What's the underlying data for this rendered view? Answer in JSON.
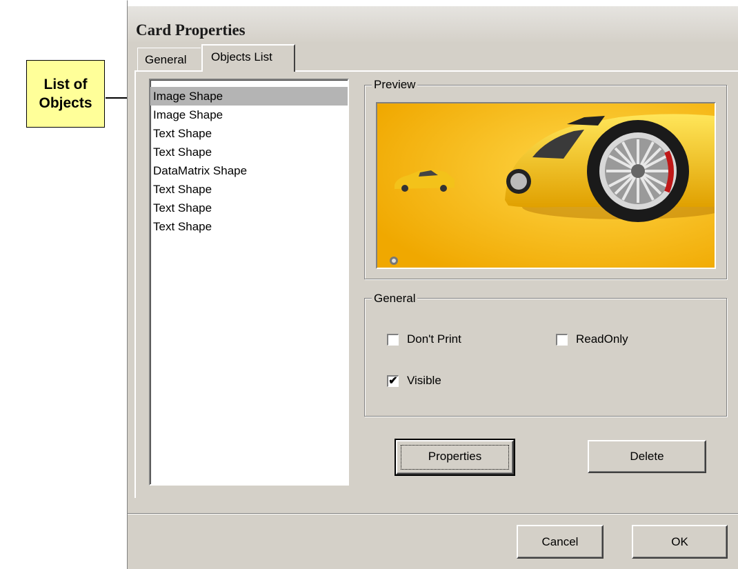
{
  "callout": {
    "text_line1": "List of",
    "text_line2": "Objects"
  },
  "dialog": {
    "title": "Card Properties",
    "tabs": [
      {
        "label": "General",
        "active": false
      },
      {
        "label": "Objects List",
        "active": true
      }
    ],
    "objects_list": {
      "items": [
        "Image Shape",
        "Image Shape",
        "Text Shape",
        "Text Shape",
        "DataMatrix Shape",
        "Text Shape",
        "Text Shape",
        "Text Shape"
      ],
      "selected_index": 0
    },
    "preview": {
      "label": "Preview",
      "image": "yellow-car-card-image"
    },
    "general": {
      "label": "General",
      "dont_print": {
        "label": "Don't Print",
        "checked": false
      },
      "read_only": {
        "label": "ReadOnly",
        "checked": false
      },
      "visible": {
        "label": "Visible",
        "checked": true
      }
    },
    "buttons": {
      "properties": "Properties",
      "delete": "Delete",
      "cancel": "Cancel",
      "ok": "OK"
    }
  },
  "colors": {
    "dialog_bg": "#d4d0c8",
    "callout_bg": "#ffff99",
    "selection_bg": "#b4b4b4",
    "preview_bg": "#f5b800"
  }
}
